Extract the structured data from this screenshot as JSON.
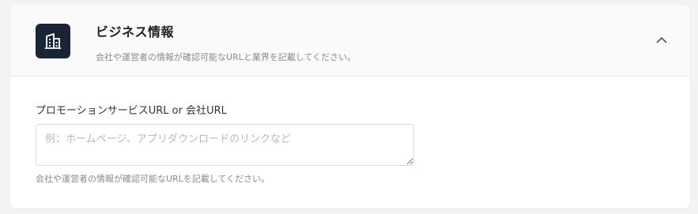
{
  "section": {
    "title": "ビジネス情報",
    "description": "会社や運営者の情報が確認可能なURLと業界を記載してください。",
    "icon": "building-icon",
    "toggle_icon": "chevron-up-icon",
    "expanded": true
  },
  "url_field": {
    "label": "プロモーションサービスURL or 会社URL",
    "value": "",
    "placeholder": "例：ホームページ、アプリダウンロードのリンクなど",
    "help": "会社や運営者の情報が確認可能なURLを記載してください。"
  },
  "colors": {
    "page_background": "#f2f3f5",
    "card_background": "#ffffff",
    "header_background": "#fafafa",
    "icon_tile": "#1a2435",
    "icon_glyph": "#ffffff",
    "title_text": "#222222",
    "muted_text": "#8a8a8a",
    "input_border": "#d9d9d9",
    "placeholder_text": "#b8b8b8"
  }
}
